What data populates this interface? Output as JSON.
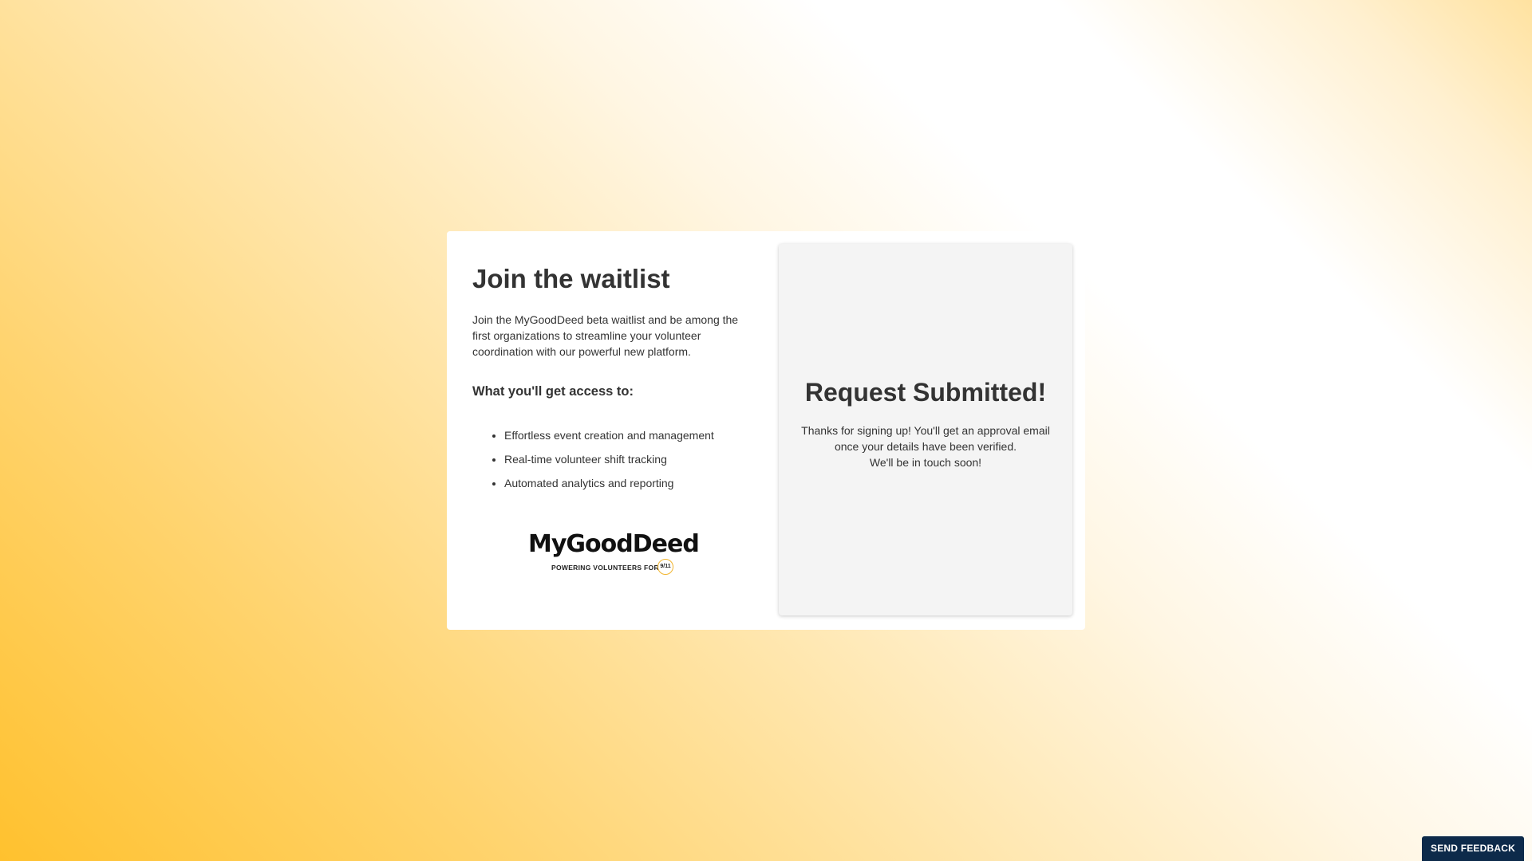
{
  "waitlist": {
    "title": "Join the waitlist",
    "intro": "Join the MyGoodDeed beta waitlist and be among the first organizations to streamline your volunteer coordination with our powerful new platform.",
    "access_heading": "What you'll get access to:",
    "features": [
      "Effortless event creation and management",
      "Real-time volunteer shift tracking",
      "Automated analytics and reporting"
    ],
    "logo": {
      "wordmark": "MyGoodDeed",
      "tagline": "POWERING VOLUNTEERS FOR",
      "badge": "9/11"
    }
  },
  "confirmation": {
    "title": "Request Submitted!",
    "line1": "Thanks for signing up! You'll get an approval email once your details have been verified.",
    "line2": "We'll be in touch soon!"
  },
  "feedback": {
    "label": "SEND FEEDBACK"
  },
  "colors": {
    "accent": "#ffc12e",
    "feedback_bg": "#0d2a4a",
    "panel_bg": "#f4f4f4",
    "text": "#333333"
  }
}
